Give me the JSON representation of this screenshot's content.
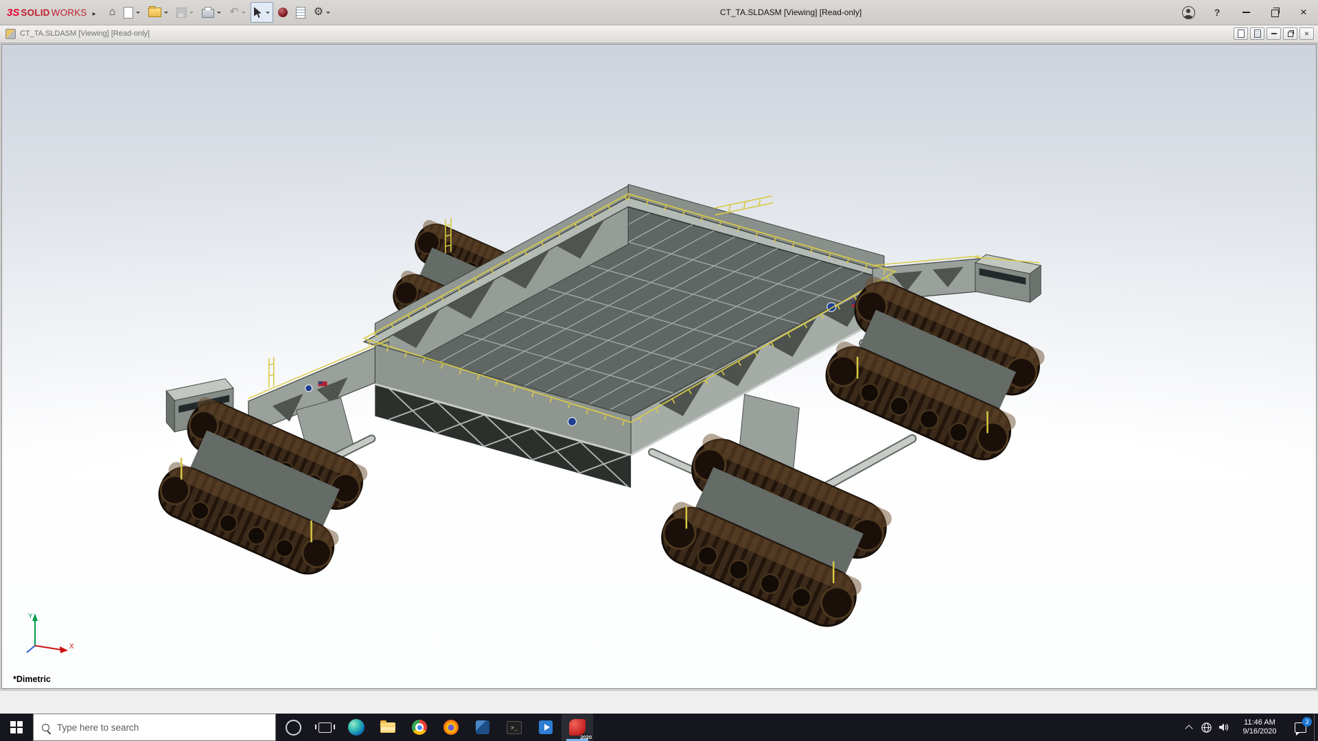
{
  "glyphs": {
    "brand_expand": "▸",
    "home": "⌂",
    "undo": "↶",
    "gear": "⚙",
    "help": "?",
    "close": "×",
    "terminal_prompt": ">_"
  },
  "titlebar": {
    "brand": {
      "mark": "3S",
      "solid": "SOLID",
      "works": "WORKS"
    },
    "title": "CT_TA.SLDASM [Viewing] [Read-only]",
    "toolbar": [
      {
        "name": "home"
      },
      {
        "name": "new-document"
      },
      {
        "name": "open"
      },
      {
        "name": "save",
        "disabled": true
      },
      {
        "name": "print"
      },
      {
        "name": "undo",
        "disabled": true
      },
      {
        "name": "select",
        "active": true
      },
      {
        "name": "render-sphere"
      },
      {
        "name": "file-properties"
      },
      {
        "name": "options"
      }
    ],
    "window_controls": [
      "sign-in",
      "help",
      "minimize",
      "restore",
      "close"
    ]
  },
  "document_window": {
    "title": "CT_TA.SLDASM [Viewing] [Read-only]",
    "controls": [
      "pane-1",
      "pane-2",
      "minimize",
      "restore",
      "close"
    ]
  },
  "viewport": {
    "orientation_label": "*Dimetric",
    "triad": {
      "x": "X",
      "y": "Y"
    }
  },
  "taskbar": {
    "search_placeholder": "Type here to search",
    "apps": [
      {
        "name": "cortana"
      },
      {
        "name": "task-view"
      },
      {
        "name": "edge"
      },
      {
        "name": "file-explorer"
      },
      {
        "name": "chrome"
      },
      {
        "name": "firefox"
      },
      {
        "name": "cube-app"
      },
      {
        "name": "terminal"
      },
      {
        "name": "video-app"
      },
      {
        "name": "solidworks",
        "badge": "2020",
        "active": true
      }
    ],
    "tray": {
      "time": "11:46 AM",
      "date": "9/16/2020",
      "notifications": "3"
    }
  }
}
